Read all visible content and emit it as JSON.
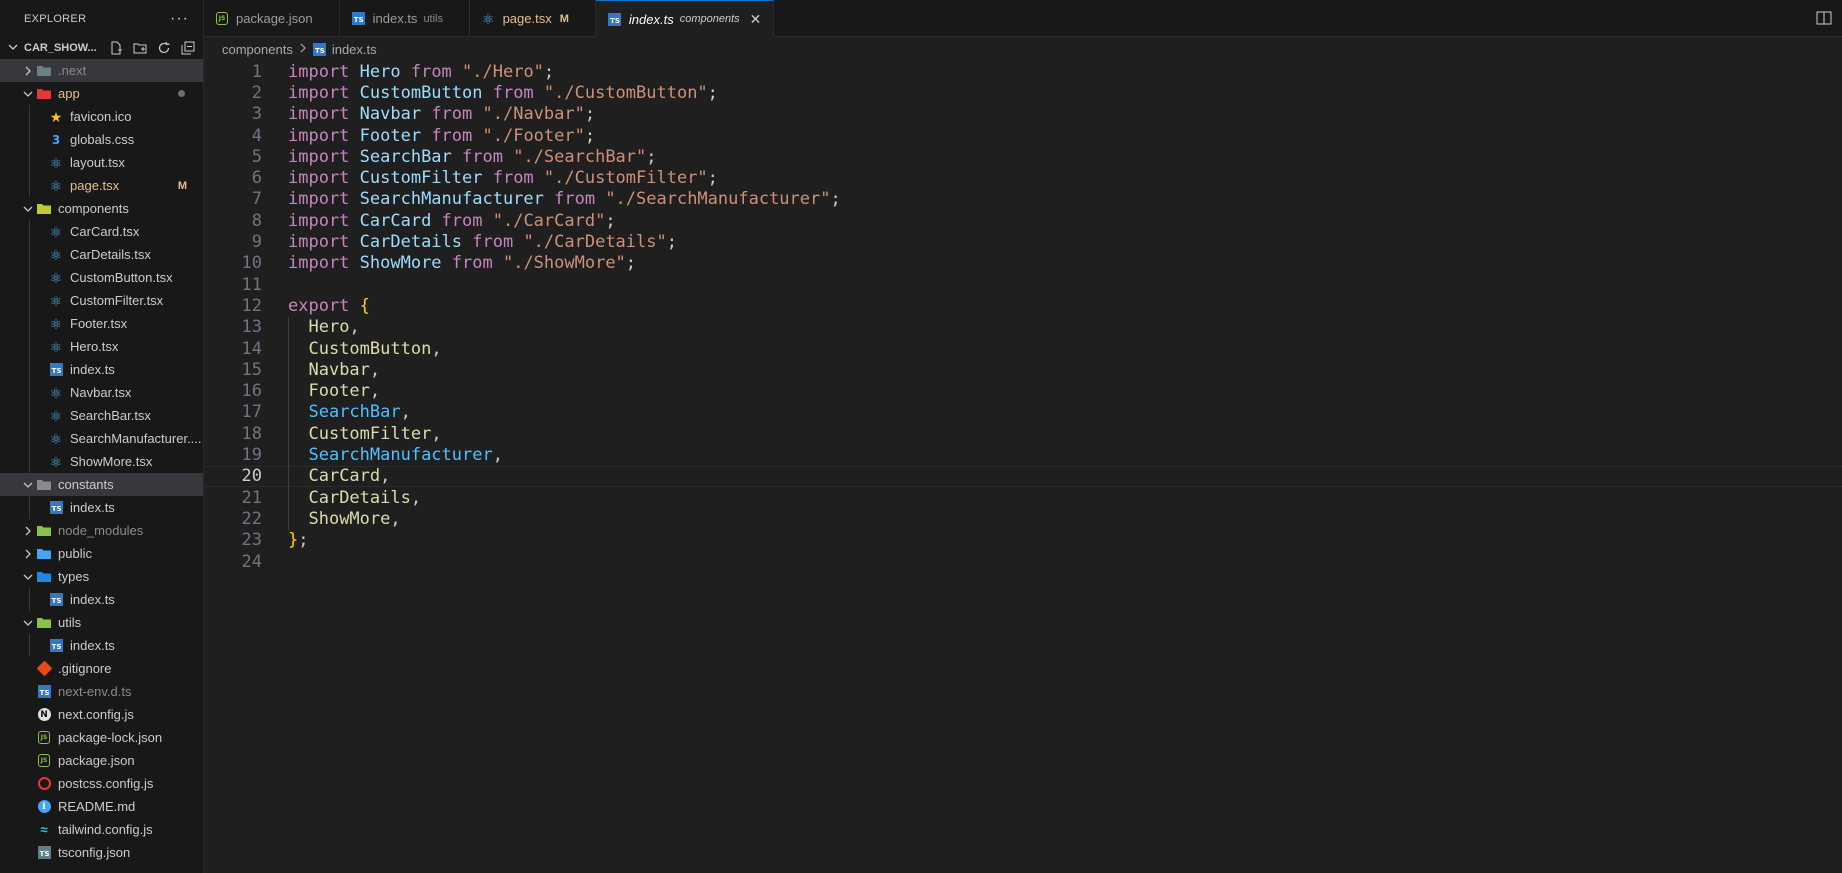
{
  "sidebar": {
    "title": "EXPLORER",
    "more": "···",
    "project": "CAR_SHOW...",
    "tree": [
      {
        "label": ".next",
        "depth": 1,
        "kind": "folder",
        "color": "#6d8086",
        "twist": ">",
        "dim": true,
        "selected": true
      },
      {
        "label": "app",
        "depth": 1,
        "kind": "folder",
        "color": "#e53935",
        "twist": "v",
        "style": "app",
        "dot": true
      },
      {
        "label": "favicon.ico",
        "depth": 2,
        "kind": "star"
      },
      {
        "label": "globals.css",
        "depth": 2,
        "kind": "css"
      },
      {
        "label": "layout.tsx",
        "depth": 2,
        "kind": "react"
      },
      {
        "label": "page.tsx",
        "depth": 2,
        "kind": "react",
        "style": "mod",
        "badge": "M"
      },
      {
        "label": "components",
        "depth": 1,
        "kind": "folder",
        "color": "#c0ca33",
        "twist": "v"
      },
      {
        "label": "CarCard.tsx",
        "depth": 2,
        "kind": "react"
      },
      {
        "label": "CarDetails.tsx",
        "depth": 2,
        "kind": "react"
      },
      {
        "label": "CustomButton.tsx",
        "depth": 2,
        "kind": "react"
      },
      {
        "label": "CustomFilter.tsx",
        "depth": 2,
        "kind": "react"
      },
      {
        "label": "Footer.tsx",
        "depth": 2,
        "kind": "react"
      },
      {
        "label": "Hero.tsx",
        "depth": 2,
        "kind": "react"
      },
      {
        "label": "index.ts",
        "depth": 2,
        "kind": "ts"
      },
      {
        "label": "Navbar.tsx",
        "depth": 2,
        "kind": "react"
      },
      {
        "label": "SearchBar.tsx",
        "depth": 2,
        "kind": "react"
      },
      {
        "label": "SearchManufacturer....",
        "depth": 2,
        "kind": "react"
      },
      {
        "label": "ShowMore.tsx",
        "depth": 2,
        "kind": "react"
      },
      {
        "label": "constants",
        "depth": 1,
        "kind": "folder",
        "color": "#8a8a8a",
        "twist": "v",
        "selected": true
      },
      {
        "label": "index.ts",
        "depth": 2,
        "kind": "ts"
      },
      {
        "label": "node_modules",
        "depth": 1,
        "kind": "folder",
        "color": "#8bc34a",
        "twist": ">",
        "dim": true
      },
      {
        "label": "public",
        "depth": 1,
        "kind": "folder",
        "color": "#42a5f5",
        "twist": ">"
      },
      {
        "label": "types",
        "depth": 1,
        "kind": "folder",
        "color": "#1e88e5",
        "twist": "v"
      },
      {
        "label": "index.ts",
        "depth": 2,
        "kind": "ts"
      },
      {
        "label": "utils",
        "depth": 1,
        "kind": "folder",
        "color": "#8bc34a",
        "twist": "v"
      },
      {
        "label": "index.ts",
        "depth": 2,
        "kind": "ts"
      },
      {
        "label": ".gitignore",
        "depth": 1,
        "kind": "git"
      },
      {
        "label": "next-env.d.ts",
        "depth": 1,
        "kind": "ts",
        "dim": true
      },
      {
        "label": "next.config.js",
        "depth": 1,
        "kind": "next"
      },
      {
        "label": "package-lock.json",
        "depth": 1,
        "kind": "json"
      },
      {
        "label": "package.json",
        "depth": 1,
        "kind": "json"
      },
      {
        "label": "postcss.config.js",
        "depth": 1,
        "kind": "postcss"
      },
      {
        "label": "README.md",
        "depth": 1,
        "kind": "info"
      },
      {
        "label": "tailwind.config.js",
        "depth": 1,
        "kind": "tailwind"
      },
      {
        "label": "tsconfig.json",
        "depth": 1,
        "kind": "tsconfig"
      }
    ]
  },
  "tabs": [
    {
      "label": "package.json",
      "kind": "json"
    },
    {
      "label": "index.ts",
      "sub": "utils",
      "kind": "ts"
    },
    {
      "label": "page.tsx",
      "flag": "M",
      "kind": "react",
      "modified": true
    },
    {
      "label": "index.ts",
      "sub": "components",
      "kind": "ts",
      "active": true,
      "close": "✕"
    }
  ],
  "breadcrumb": {
    "folder": "components",
    "file": "index.ts"
  },
  "editor": {
    "current_line": 20,
    "lines": [
      [
        [
          "kw",
          "import "
        ],
        [
          "id",
          "Hero"
        ],
        [
          "kw",
          " from "
        ],
        [
          "str",
          "\"./Hero\""
        ],
        [
          "punc",
          ";"
        ]
      ],
      [
        [
          "kw",
          "import "
        ],
        [
          "id",
          "CustomButton"
        ],
        [
          "kw",
          " from "
        ],
        [
          "str",
          "\"./CustomButton\""
        ],
        [
          "punc",
          ";"
        ]
      ],
      [
        [
          "kw",
          "import "
        ],
        [
          "id",
          "Navbar"
        ],
        [
          "kw",
          " from "
        ],
        [
          "str",
          "\"./Navbar\""
        ],
        [
          "punc",
          ";"
        ]
      ],
      [
        [
          "kw",
          "import "
        ],
        [
          "id",
          "Footer"
        ],
        [
          "kw",
          " from "
        ],
        [
          "str",
          "\"./Footer\""
        ],
        [
          "punc",
          ";"
        ]
      ],
      [
        [
          "kw",
          "import "
        ],
        [
          "id",
          "SearchBar"
        ],
        [
          "kw",
          " from "
        ],
        [
          "str",
          "\"./SearchBar\""
        ],
        [
          "punc",
          ";"
        ]
      ],
      [
        [
          "kw",
          "import "
        ],
        [
          "id",
          "CustomFilter"
        ],
        [
          "kw",
          " from "
        ],
        [
          "str",
          "\"./CustomFilter\""
        ],
        [
          "punc",
          ";"
        ]
      ],
      [
        [
          "kw",
          "import "
        ],
        [
          "id",
          "SearchManufacturer"
        ],
        [
          "kw",
          " from "
        ],
        [
          "str",
          "\"./SearchManufacturer\""
        ],
        [
          "punc",
          ";"
        ]
      ],
      [
        [
          "kw",
          "import "
        ],
        [
          "id",
          "CarCard"
        ],
        [
          "kw",
          " from "
        ],
        [
          "str",
          "\"./CarCard\""
        ],
        [
          "punc",
          ";"
        ]
      ],
      [
        [
          "kw",
          "import "
        ],
        [
          "id",
          "CarDetails"
        ],
        [
          "kw",
          " from "
        ],
        [
          "str",
          "\"./CarDetails\""
        ],
        [
          "punc",
          ";"
        ]
      ],
      [
        [
          "kw",
          "import "
        ],
        [
          "id",
          "ShowMore"
        ],
        [
          "kw",
          " from "
        ],
        [
          "str",
          "\"./ShowMore\""
        ],
        [
          "punc",
          ";"
        ]
      ],
      [],
      [
        [
          "kw",
          "export "
        ],
        [
          "brace",
          "{"
        ]
      ],
      [
        [
          "punc",
          "  "
        ],
        [
          "yl",
          "Hero"
        ],
        [
          "punc",
          ","
        ]
      ],
      [
        [
          "punc",
          "  "
        ],
        [
          "yl",
          "CustomButton"
        ],
        [
          "punc",
          ","
        ]
      ],
      [
        [
          "punc",
          "  "
        ],
        [
          "yl",
          "Navbar"
        ],
        [
          "punc",
          ","
        ]
      ],
      [
        [
          "punc",
          "  "
        ],
        [
          "yl",
          "Footer"
        ],
        [
          "punc",
          ","
        ]
      ],
      [
        [
          "punc",
          "  "
        ],
        [
          "blue",
          "SearchBar"
        ],
        [
          "punc",
          ","
        ]
      ],
      [
        [
          "punc",
          "  "
        ],
        [
          "yl",
          "CustomFilter"
        ],
        [
          "punc",
          ","
        ]
      ],
      [
        [
          "punc",
          "  "
        ],
        [
          "blue",
          "SearchManufacturer"
        ],
        [
          "punc",
          ","
        ]
      ],
      [
        [
          "punc",
          "  "
        ],
        [
          "yl",
          "CarCard"
        ],
        [
          "punc",
          ","
        ]
      ],
      [
        [
          "punc",
          "  "
        ],
        [
          "yl",
          "CarDetails"
        ],
        [
          "punc",
          ","
        ]
      ],
      [
        [
          "punc",
          "  "
        ],
        [
          "yl",
          "ShowMore"
        ],
        [
          "punc",
          ","
        ]
      ],
      [
        [
          "brace",
          "}"
        ],
        [
          "punc",
          ";"
        ]
      ],
      []
    ]
  }
}
